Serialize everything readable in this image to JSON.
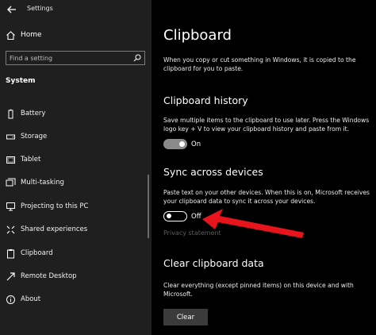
{
  "window": {
    "title": "Settings"
  },
  "sidebar": {
    "home_label": "Home",
    "search": {
      "placeholder": "Find a setting"
    },
    "section_label": "System",
    "items": [
      {
        "label": "Battery",
        "icon": "battery-icon"
      },
      {
        "label": "Storage",
        "icon": "storage-icon"
      },
      {
        "label": "Tablet",
        "icon": "tablet-icon"
      },
      {
        "label": "Multi-tasking",
        "icon": "multitasking-icon"
      },
      {
        "label": "Projecting to this PC",
        "icon": "projecting-icon"
      },
      {
        "label": "Shared experiences",
        "icon": "shared-experiences-icon"
      },
      {
        "label": "Clipboard",
        "icon": "clipboard-icon"
      },
      {
        "label": "Remote Desktop",
        "icon": "remote-desktop-icon"
      },
      {
        "label": "About",
        "icon": "info-icon"
      }
    ]
  },
  "main": {
    "title": "Clipboard",
    "intro": "When you copy or cut something in Windows, it is copied to the clipboard for you to paste.",
    "history": {
      "heading": "Clipboard history",
      "description": "Save multiple items to the clipboard to use later. Press the Windows logo key + V to view your clipboard history and paste from it.",
      "toggle_state": "On"
    },
    "sync": {
      "heading": "Sync across devices",
      "description": "Paste text on your other devices. When this is on, Microsoft receives your clipboard data to sync it across your devices.",
      "toggle_state": "Off",
      "privacy_link": "Privacy statement"
    },
    "clear": {
      "heading": "Clear clipboard data",
      "description": "Clear everything (except pinned items) on this device and with Microsoft.",
      "button_label": "Clear"
    }
  },
  "colors": {
    "arrow": "#e8141c",
    "sidebar_bg": "#1f1f1f",
    "main_bg": "#000000"
  }
}
